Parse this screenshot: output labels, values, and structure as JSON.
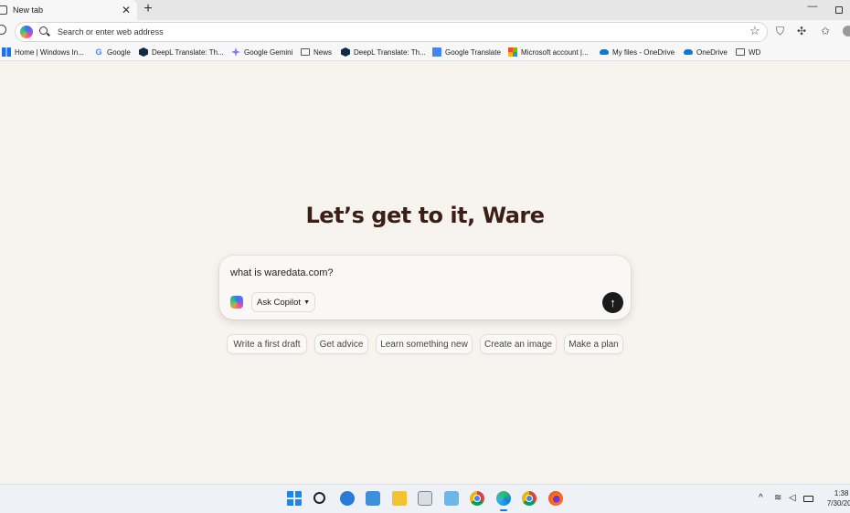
{
  "browser": {
    "tab_title": "New tab",
    "tab_close": "✕",
    "new_tab": "+",
    "minimize": "—",
    "address_placeholder": "Search or enter web address"
  },
  "bookmarks": [
    {
      "label": "Home | Windows In...",
      "icon": "windows-icon"
    },
    {
      "label": "Google",
      "icon": "google-icon"
    },
    {
      "label": "DeepL Translate: Th...",
      "icon": "deepl-icon"
    },
    {
      "label": "Google Gemini",
      "icon": "gemini-icon"
    },
    {
      "label": "News",
      "icon": "folder-icon"
    },
    {
      "label": "DeepL Translate: Th...",
      "icon": "deepl-icon"
    },
    {
      "label": "Google Translate",
      "icon": "google-translate-icon"
    },
    {
      "label": "Microsoft account |...",
      "icon": "microsoft-icon"
    },
    {
      "label": "My files - OneDrive",
      "icon": "onedrive-icon"
    },
    {
      "label": "OneDrive",
      "icon": "onedrive-icon"
    },
    {
      "label": "WD",
      "icon": "folder-icon"
    }
  ],
  "main": {
    "greeting": "Let’s get to it, Ware",
    "query": "what is waredata.com?",
    "mode_label": "Ask Copilot",
    "send_glyph": "↑",
    "suggestions": [
      "Write a first draft",
      "Get advice",
      "Learn something new",
      "Create an image",
      "Make a plan"
    ]
  },
  "taskbar": {
    "time": "1:38 P",
    "date": "7/30/202",
    "tray_chevron": "^"
  },
  "colors": {
    "background": "#f7f3ef",
    "greeting": "#3b1f14",
    "send_button": "#1b1b1b"
  }
}
